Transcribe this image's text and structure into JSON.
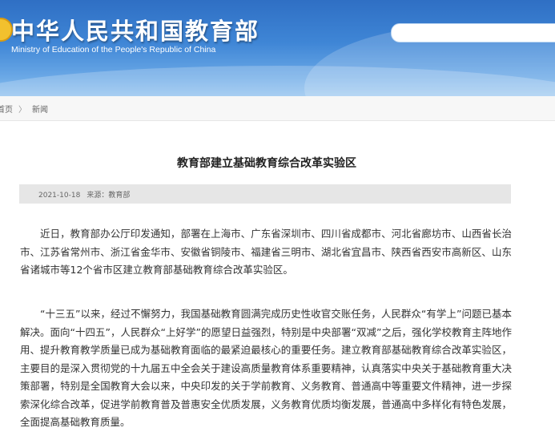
{
  "header": {
    "site_title": "中华人民共和国教育部",
    "site_subtitle": "Ministry of Education of the People's Republic of China",
    "colors": {
      "header_top": "#2f6fc4",
      "header_bottom": "#8fc0ee"
    }
  },
  "search": {
    "value": ""
  },
  "breadcrumb": {
    "home": "首页",
    "separator": "〉",
    "current": "新闻"
  },
  "article": {
    "title": "教育部建立基础教育综合改革实验区",
    "date": "2021-10-18",
    "source": "来源：教育部",
    "paragraphs": [
      "近日，教育部办公厅印发通知，部署在上海市、广东省深圳市、四川省成都市、河北省廊坊市、山西省长治市、江苏省常州市、浙江省金华市、安徽省铜陵市、福建省三明市、湖北省宜昌市、陕西省西安市高新区、山东省诸城市等12个省市区建立教育部基础教育综合改革实验区。",
      "“十三五”以来，经过不懈努力，我国基础教育圆满完成历史性收官交账任务，人民群众“有学上”问题已基本解决。面向“十四五”，人民群众“上好学”的愿望日益强烈，特别是中央部署“双减”之后，强化学校教育主阵地作用、提升教育教学质量已成为基础教育面临的最紧迫最核心的重要任务。建立教育部基础教育综合改革实验区，主要目的是深入贯彻党的十九届五中全会关于建设高质量教育体系重要精神，认真落实中央关于基础教育重大决策部署，特别是全国教育大会以来，中央印发的关于学前教育、义务教育、普通高中等重要文件精神，进一步探索深化综合改革，促进学前教育普及普惠安全优质发展，义务教育优质均衡发展，普通高中多样化有特色发展，全面提高基础教育质量。"
    ]
  }
}
